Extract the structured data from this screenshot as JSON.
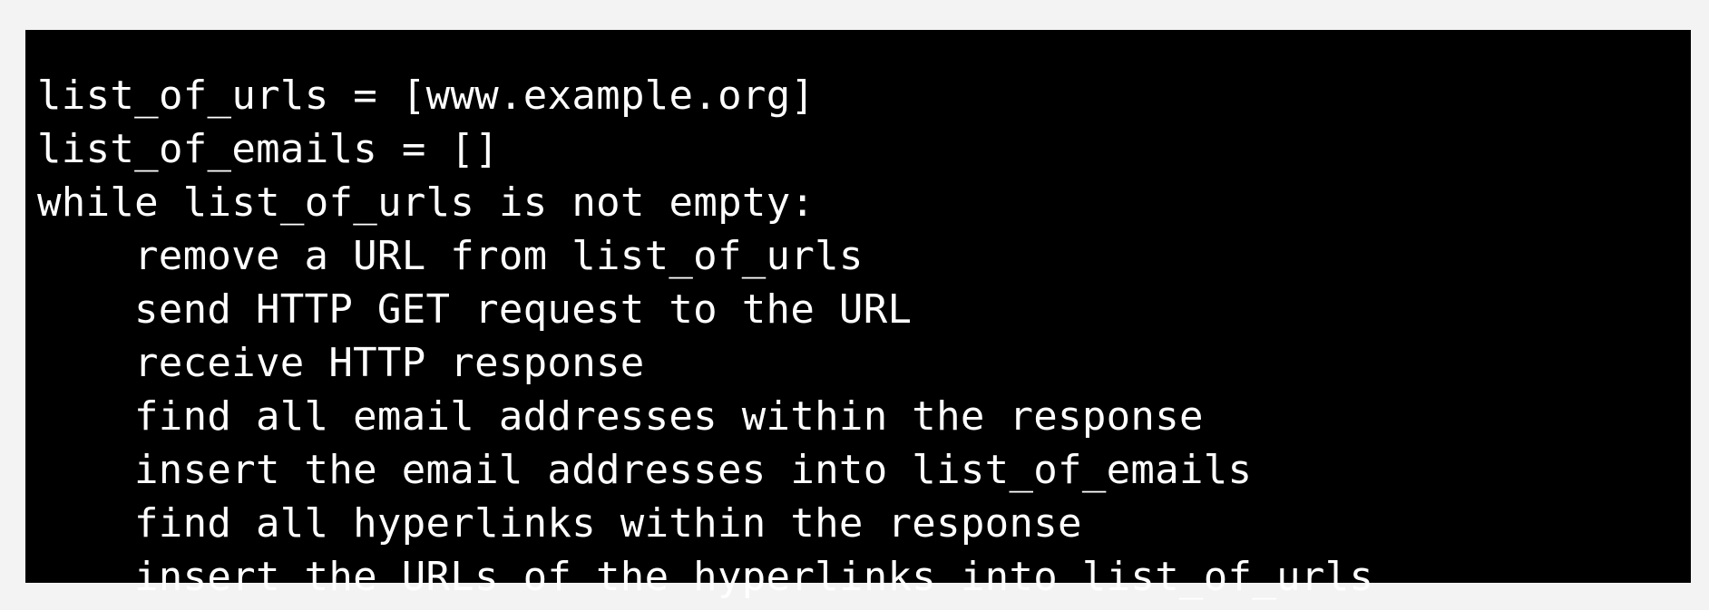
{
  "code": {
    "lines": [
      "list_of_urls = [www.example.org]",
      "list_of_emails = []",
      "while list_of_urls is not empty:",
      "remove a URL from list_of_urls",
      "send HTTP GET request to the URL",
      "receive HTTP response",
      "find all email addresses within the response",
      "insert the email addresses into list_of_emails",
      "find all hyperlinks within the response",
      "insert the URLs of the hyperlinks into list_of_urls"
    ]
  },
  "colors": {
    "panel_background": "#000000",
    "text": "#ffffff",
    "page_background": "#f3f3f3"
  }
}
